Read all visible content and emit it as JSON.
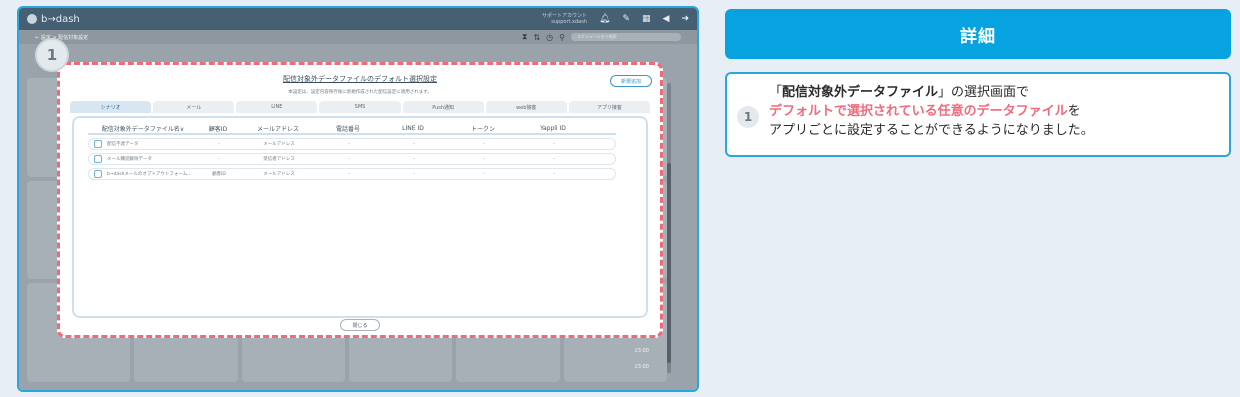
{
  "app": {
    "logo": "b→dash",
    "account": "サポートアカウント",
    "account_sub": "support.xdash",
    "breadcrumb": "← 設定 > 配信対象設定",
    "search_placeholder": "スケジュール名で検索",
    "times": [
      "23:00",
      "23:00"
    ]
  },
  "step_badge": "1",
  "modal": {
    "title": "配信対象外データファイルのデフォルト選択設定",
    "subtitle": "本設定は、設定内容保存後に新規作成された配信設定に適用されます。",
    "new_button": "新規追加",
    "tabs": [
      "シナリオ",
      "メール",
      "LINE",
      "SMS",
      "Push通知",
      "web接客",
      "アプリ接客"
    ],
    "columns": [
      "配信対象外データファイル名∨",
      "顧客ID",
      "メールアドレス",
      "電話番号",
      "LINE ID",
      "トークン",
      "Yappli ID"
    ],
    "rows": [
      {
        "name": "配信不達データ",
        "cells": [
          "-",
          "メールアドレス",
          "-",
          "-",
          "-",
          "-"
        ]
      },
      {
        "name": "メール購読解除データ",
        "cells": [
          "-",
          "受信者アドレス",
          "-",
          "-",
          "-",
          "-"
        ]
      },
      {
        "name": "b→dashメールのオプトアウトフォーム...",
        "cells": [
          "顧客ID",
          "メールアドレス",
          "-",
          "-",
          "-",
          "-"
        ]
      }
    ],
    "close_button": "閉じる"
  },
  "detail": {
    "header": "詳細",
    "badge": "1",
    "line1_prefix": "「",
    "line1_bold": "配信対象外データファイル",
    "line1_suffix": "」の選択画面で",
    "line2_red": "デフォルトで選択されている任意のデータファイル",
    "line2_suffix": "を",
    "line3": "アプリごとに設定することができるようになりました。"
  }
}
